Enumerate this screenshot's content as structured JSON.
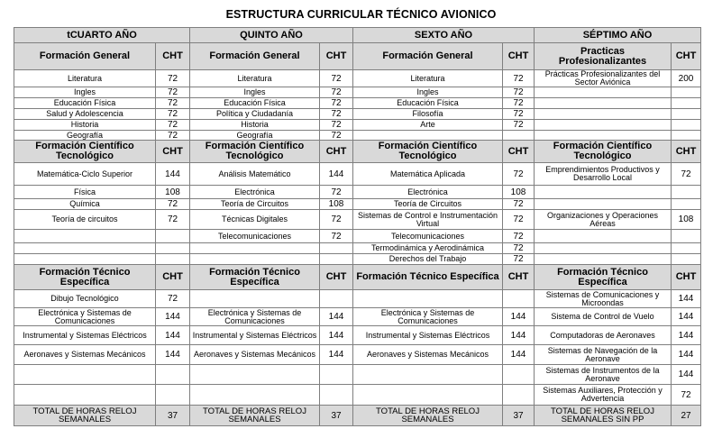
{
  "title": "ESTRUCTURA CURRICULAR TÉCNICO AVIONICO",
  "years": [
    "tCUARTO AÑO",
    "QUINTO AÑO",
    "SEXTO AÑO",
    "SÉPTIMO AÑO"
  ],
  "cht_label": "CHT",
  "sections": [
    {
      "headers": [
        "Formación General",
        "Formación General",
        "Formación General",
        "Practicas Profesionalizantes"
      ],
      "rows": [
        [
          [
            "Literatura",
            "72"
          ],
          [
            "Literatura",
            "72"
          ],
          [
            "Literatura",
            "72"
          ],
          [
            "Prácticas Profesionalizantes del Sector Aviónica",
            "200"
          ]
        ],
        [
          [
            "Ingles",
            "72"
          ],
          [
            "Ingles",
            "72"
          ],
          [
            "Ingles",
            "72"
          ],
          [
            "",
            ""
          ]
        ],
        [
          [
            "Educación Física",
            "72"
          ],
          [
            "Educación Física",
            "72"
          ],
          [
            "Educación Física",
            "72"
          ],
          [
            "",
            ""
          ]
        ],
        [
          [
            "Salud y Adolescencia",
            "72"
          ],
          [
            "Política y Ciudadanía",
            "72"
          ],
          [
            "Filosofía",
            "72"
          ],
          [
            "",
            ""
          ]
        ],
        [
          [
            "Historia",
            "72"
          ],
          [
            "Historia",
            "72"
          ],
          [
            "Arte",
            "72"
          ],
          [
            "",
            ""
          ]
        ],
        [
          [
            "Geografía",
            "72"
          ],
          [
            "Geografía",
            "72"
          ],
          [
            "",
            ""
          ],
          [
            "",
            ""
          ]
        ]
      ]
    },
    {
      "headers": [
        "Formación Científico Tecnológico",
        "Formación Científico Tecnológico",
        "Formación Científico Tecnológico",
        "Formación Científico Tecnológico"
      ],
      "rows": [
        [
          [
            "Matemática-Ciclo Superior",
            "144"
          ],
          [
            "Análisis Matemático",
            "144"
          ],
          [
            "Matemática Aplicada",
            "72"
          ],
          [
            "Emprendimientos Productivos y Desarrollo Local",
            "72"
          ]
        ],
        [
          [
            "Física",
            "108"
          ],
          [
            "Electrónica",
            "72"
          ],
          [
            "Electrónica",
            "108"
          ],
          [
            "",
            ""
          ]
        ],
        [
          [
            "Química",
            "72"
          ],
          [
            "Teoría de Circuitos",
            "108"
          ],
          [
            "Teoría de Circuitos",
            "72"
          ],
          [
            "",
            ""
          ]
        ],
        [
          [
            "Teoría de circuitos",
            "72"
          ],
          [
            "Técnicas Digitales",
            "72"
          ],
          [
            "Sistemas de Control e Instrumentación Virtual",
            "72"
          ],
          [
            "Organizaciones y Operaciones Aéreas",
            "108"
          ]
        ],
        [
          [
            "",
            ""
          ],
          [
            "Telecomunicaciones",
            "72"
          ],
          [
            "Telecomunicaciones",
            "72"
          ],
          [
            "",
            ""
          ]
        ],
        [
          [
            "",
            ""
          ],
          [
            "",
            ""
          ],
          [
            "Termodinámica y Aerodinámica",
            "72"
          ],
          [
            "",
            ""
          ]
        ],
        [
          [
            "",
            ""
          ],
          [
            "",
            ""
          ],
          [
            "Derechos del Trabajo",
            "72"
          ],
          [
            "",
            ""
          ]
        ]
      ]
    },
    {
      "headers": [
        "Formación Técnico Específica",
        "Formación Técnico Específica",
        "Formación Técnico Específica",
        "Formación Técnico Específica"
      ],
      "rows": [
        [
          [
            "Dibujo Tecnológico",
            "72"
          ],
          [
            "",
            ""
          ],
          [
            "",
            ""
          ],
          [
            "Sistemas de Comunicaciones y Microondas",
            "144"
          ]
        ],
        [
          [
            "Electrónica y Sistemas de Comunicaciones",
            "144"
          ],
          [
            "Electrónica y Sistemas de Comunicaciones",
            "144"
          ],
          [
            "Electrónica y Sistemas de Comunicaciones",
            "144"
          ],
          [
            "Sistema de Control de Vuelo",
            "144"
          ]
        ],
        [
          [
            "Instrumental y Sistemas Eléctricos",
            "144"
          ],
          [
            "Instrumental y Sistemas Eléctricos",
            "144"
          ],
          [
            "Instrumental y Sistemas Eléctricos",
            "144"
          ],
          [
            "Computadoras de Aeronaves",
            "144"
          ]
        ],
        [
          [
            "Aeronaves y Sistemas Mecánicos",
            "144"
          ],
          [
            "Aeronaves y Sistemas Mecánicos",
            "144"
          ],
          [
            "Aeronaves y Sistemas Mecánicos",
            "144"
          ],
          [
            "Sistemas de Navegación de la Aeronave",
            "144"
          ]
        ],
        [
          [
            "",
            ""
          ],
          [
            "",
            ""
          ],
          [
            "",
            ""
          ],
          [
            "Sistemas de Instrumentos de la Aeronave",
            "144"
          ]
        ],
        [
          [
            "",
            ""
          ],
          [
            "",
            ""
          ],
          [
            "",
            ""
          ],
          [
            "Sistemas Auxiliares, Protección y Advertencia",
            "72"
          ]
        ]
      ]
    }
  ],
  "totals": [
    [
      "TOTAL DE HORAS RELOJ SEMANALES",
      "37"
    ],
    [
      "TOTAL DE HORAS RELOJ SEMANALES",
      "37"
    ],
    [
      "TOTAL DE HORAS RELOJ SEMANALES",
      "37"
    ],
    [
      "TOTAL DE HORAS RELOJ SEMANALES SIN PP",
      "27"
    ]
  ]
}
